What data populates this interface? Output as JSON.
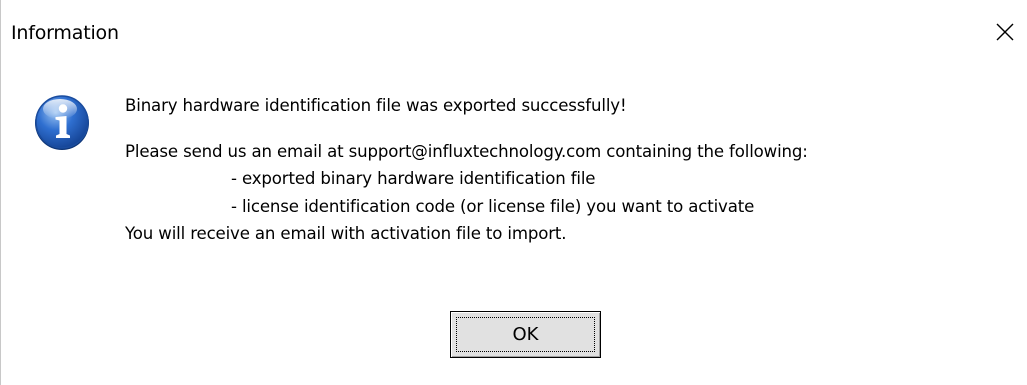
{
  "window": {
    "title": "Information",
    "close_icon": "close-icon"
  },
  "message": {
    "icon": "information-icon",
    "line1": "Binary hardware identification file was exported successfully!",
    "line2": "Please send us an email at support@influxtechnology.com containing the following:",
    "line3": "- exported binary hardware identification file",
    "line4": "- license identification code (or license file) you want to activate",
    "line5": "You will receive an email with activation file to import."
  },
  "buttons": {
    "ok_label": "OK"
  },
  "colors": {
    "icon_blue": "#1f5fbf",
    "button_face": "#e1e1e1"
  }
}
